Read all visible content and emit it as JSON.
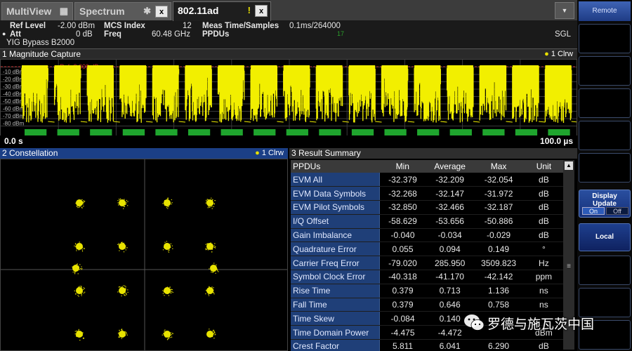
{
  "tabs": [
    {
      "label": "MultiView",
      "icon": "grid-icon"
    },
    {
      "label": "Spectrum",
      "icon": "star-icon",
      "close": "x"
    },
    {
      "label": "802.11ad",
      "icon": "warning-icon",
      "warn_mark": "!",
      "close": "x"
    }
  ],
  "menu_dropdown": "▼",
  "header": {
    "ref_level_label": "Ref Level",
    "ref_level_value": "-2.00 dBm",
    "att_label": "Att",
    "att_value": "0 dB",
    "yig": "YIG Bypass B2000",
    "mcs_label": "MCS Index",
    "mcs_value": "12",
    "freq_label": "Freq",
    "freq_value": "60.48 GHz",
    "meas_label": "Meas Time/Samples",
    "meas_value": "0.1ms/264000",
    "ppdus_label": "PPDUs",
    "ppdus_value": "17",
    "sgl": "SGL"
  },
  "magnitude": {
    "title": "1 Magnitude Capture",
    "trace": "1 Clrw",
    "ref_marker": "Ref -2.000 dBm",
    "y_labels": [
      "-10 dBm",
      "-20 dBm",
      "-30 dBm",
      "-40 dBm",
      "-50 dBm",
      "-60 dBm",
      "-70 dBm",
      "-80 dBm"
    ],
    "x_start": "0.0 s",
    "x_end": "100.0 µs",
    "bursts": 17
  },
  "constellation": {
    "title": "2 Constellation",
    "trace": "1 Clrw"
  },
  "result_summary": {
    "title": "3 Result Summary",
    "columns": [
      "PPDUs",
      "Min",
      "Average",
      "Max",
      "Unit"
    ],
    "rows": [
      {
        "name": "EVM All",
        "min": "-32.379",
        "avg": "-32.209",
        "max": "-32.054",
        "unit": "dB"
      },
      {
        "name": "EVM Data Symbols",
        "min": "-32.268",
        "avg": "-32.147",
        "max": "-31.972",
        "unit": "dB"
      },
      {
        "name": "EVM Pilot Symbols",
        "min": "-32.850",
        "avg": "-32.466",
        "max": "-32.187",
        "unit": "dB"
      },
      {
        "name": "I/Q Offset",
        "min": "-58.629",
        "avg": "-53.656",
        "max": "-50.886",
        "unit": "dB"
      },
      {
        "name": "Gain Imbalance",
        "min": "-0.040",
        "avg": "-0.034",
        "max": "-0.029",
        "unit": "dB"
      },
      {
        "name": "Quadrature Error",
        "min": "0.055",
        "avg": "0.094",
        "max": "0.149",
        "unit": "°"
      },
      {
        "name": "Carrier Freq Error",
        "min": "-79.020",
        "avg": "285.950",
        "max": "3509.823",
        "unit": "Hz"
      },
      {
        "name": "Symbol Clock Error",
        "min": "-40.318",
        "avg": "-41.170",
        "max": "-42.142",
        "unit": "ppm"
      },
      {
        "name": "Rise Time",
        "min": "0.379",
        "avg": "0.713",
        "max": "1.136",
        "unit": "ns"
      },
      {
        "name": "Fall Time",
        "min": "0.379",
        "avg": "0.646",
        "max": "0.758",
        "unit": "ns"
      },
      {
        "name": "Time Skew",
        "min": "-0.084",
        "avg": "0.140",
        "max": "",
        "unit": ""
      },
      {
        "name": "Time Domain Power",
        "min": "-4.475",
        "avg": "-4.472",
        "max": "",
        "unit": "dBm"
      },
      {
        "name": "Crest Factor",
        "min": "5.811",
        "avg": "6.041",
        "max": "6.290",
        "unit": "dB"
      }
    ]
  },
  "softkeys": {
    "remote": "Remote",
    "display_update_label": "Display Update",
    "display_on": "On",
    "display_off": "Off",
    "local": "Local"
  },
  "watermark": "罗德与施瓦茨中国",
  "colors": {
    "trace": "#f2ef00",
    "burst_marker": "#1fa52e",
    "constellation": "#e8e300",
    "panel_title_blue": "#1b3f86",
    "softkey_blue": "#2a4fa0"
  }
}
